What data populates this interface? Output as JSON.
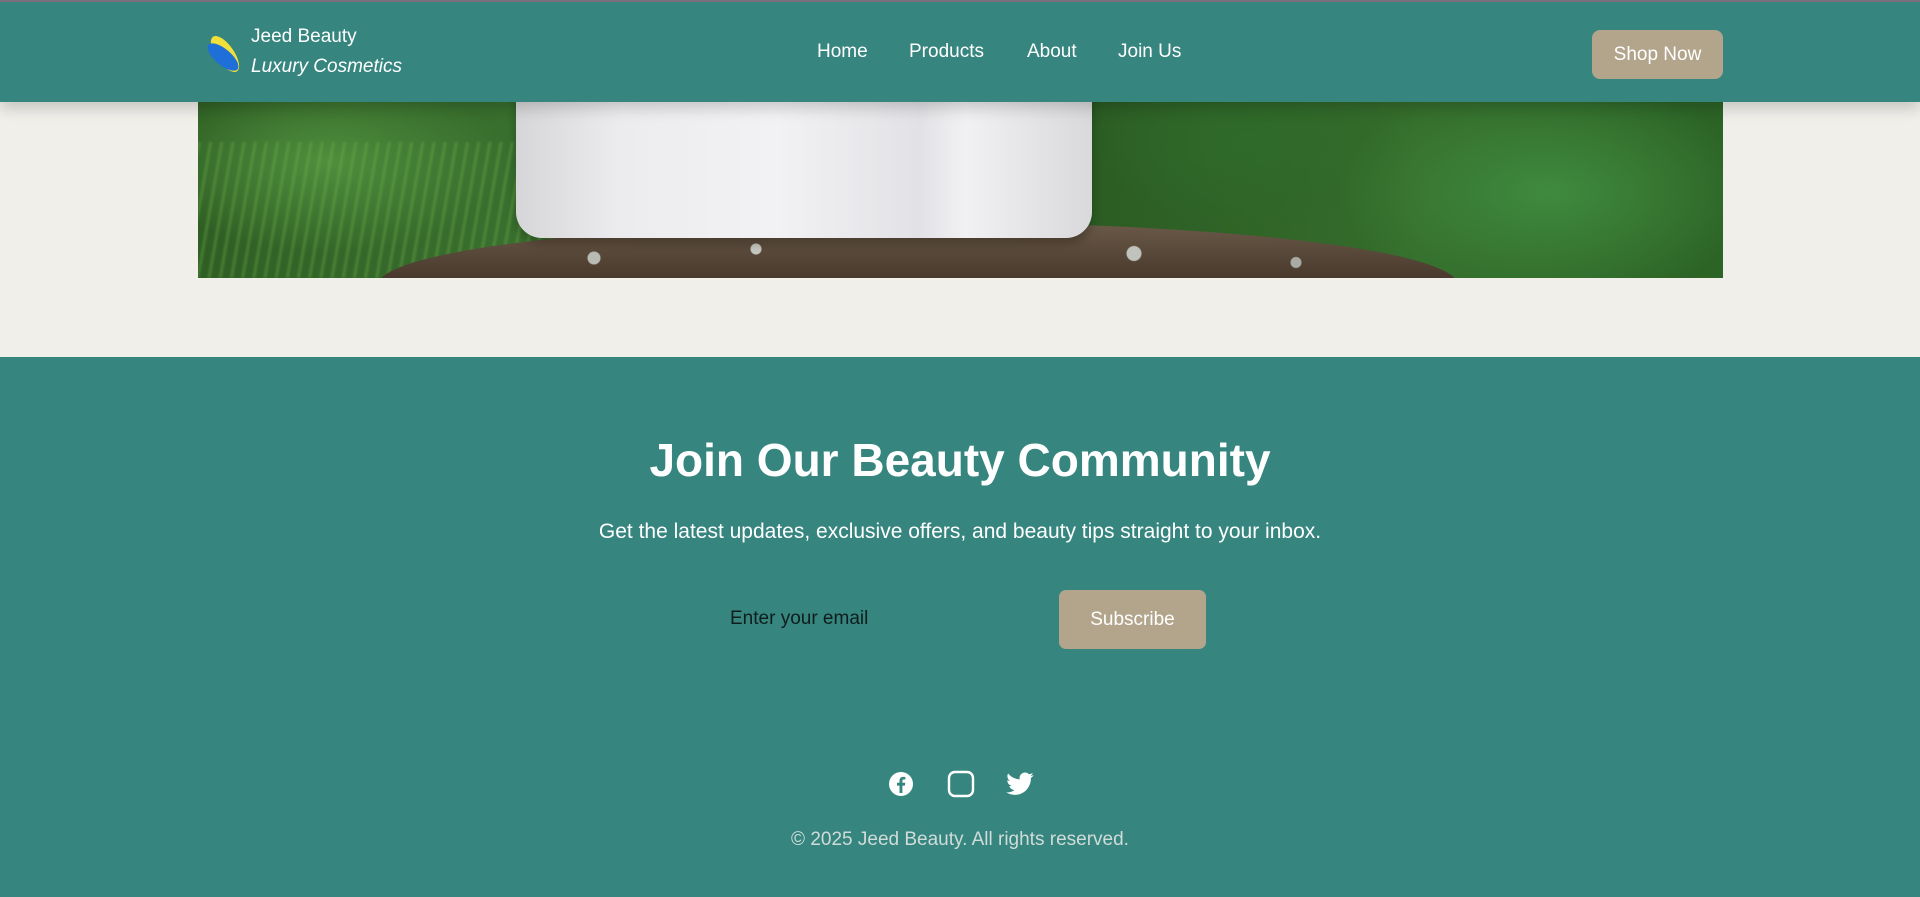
{
  "header": {
    "brand_name": "Jeed Beauty",
    "brand_tagline": "Luxury Cosmetics",
    "logo_icon": "leaf-logo-icon",
    "nav": [
      {
        "label": "Home"
      },
      {
        "label": "Products"
      },
      {
        "label": "About"
      },
      {
        "label": "Join Us"
      }
    ],
    "cta_label": "Shop Now"
  },
  "hero": {
    "image": "white-jar-on-mossy-rock"
  },
  "newsletter": {
    "title": "Join Our Beauty Community",
    "subtitle": "Get the latest updates, exclusive offers, and beauty tips straight to your inbox.",
    "email_placeholder": "Enter your email",
    "subscribe_label": "Subscribe"
  },
  "footer": {
    "socials": [
      {
        "icon": "facebook-icon"
      },
      {
        "icon": "instagram-icon"
      },
      {
        "icon": "twitter-icon"
      }
    ],
    "copyright": "© 2025 Jeed Beauty. All rights reserved."
  },
  "colors": {
    "primary": "#36857f",
    "accent": "#b3a58c",
    "background": "#f0efea",
    "text_light": "#ffffff"
  }
}
